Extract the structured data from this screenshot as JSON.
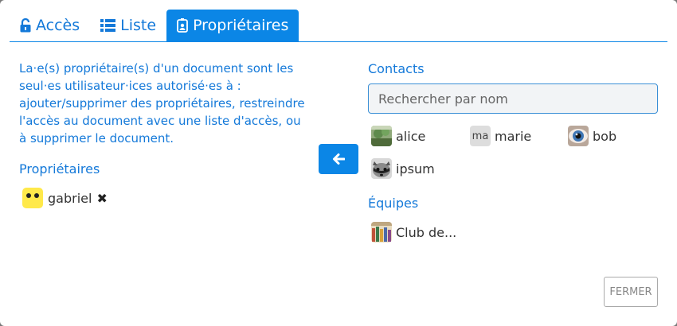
{
  "tabs": [
    {
      "label": "Accès",
      "icon": "unlock-icon"
    },
    {
      "label": "Liste",
      "icon": "list-icon"
    },
    {
      "label": "Propriétaires",
      "icon": "id-badge-icon",
      "active": true
    }
  ],
  "description": "La·e(s) propriétaire(s) d'un document sont les seul·es utilisateur·ices autorisé·es à : ajouter/supprimer des propriétaires, restreindre l'accès au document avec une liste d'accès, ou à supprimer le document.",
  "owners_title": "Propriétaires",
  "owners": [
    {
      "name": "gabriel",
      "remove_symbol": "✖"
    }
  ],
  "contacts_title": "Contacts",
  "search": {
    "placeholder": "Rechercher par nom",
    "value": ""
  },
  "contacts": [
    {
      "name": "alice",
      "avatar": "landscape-photo"
    },
    {
      "name": "marie",
      "avatar": "initials",
      "initials": "ma"
    },
    {
      "name": "bob",
      "avatar": "eye-photo"
    },
    {
      "name": "ipsum",
      "avatar": "raccoon-photo"
    }
  ],
  "teams_title": "Équipes",
  "teams": [
    {
      "name": "Club de..."
    }
  ],
  "close_label": "FERMER",
  "colors": {
    "accent": "#0b86e6",
    "text_accent": "#1479d9"
  }
}
